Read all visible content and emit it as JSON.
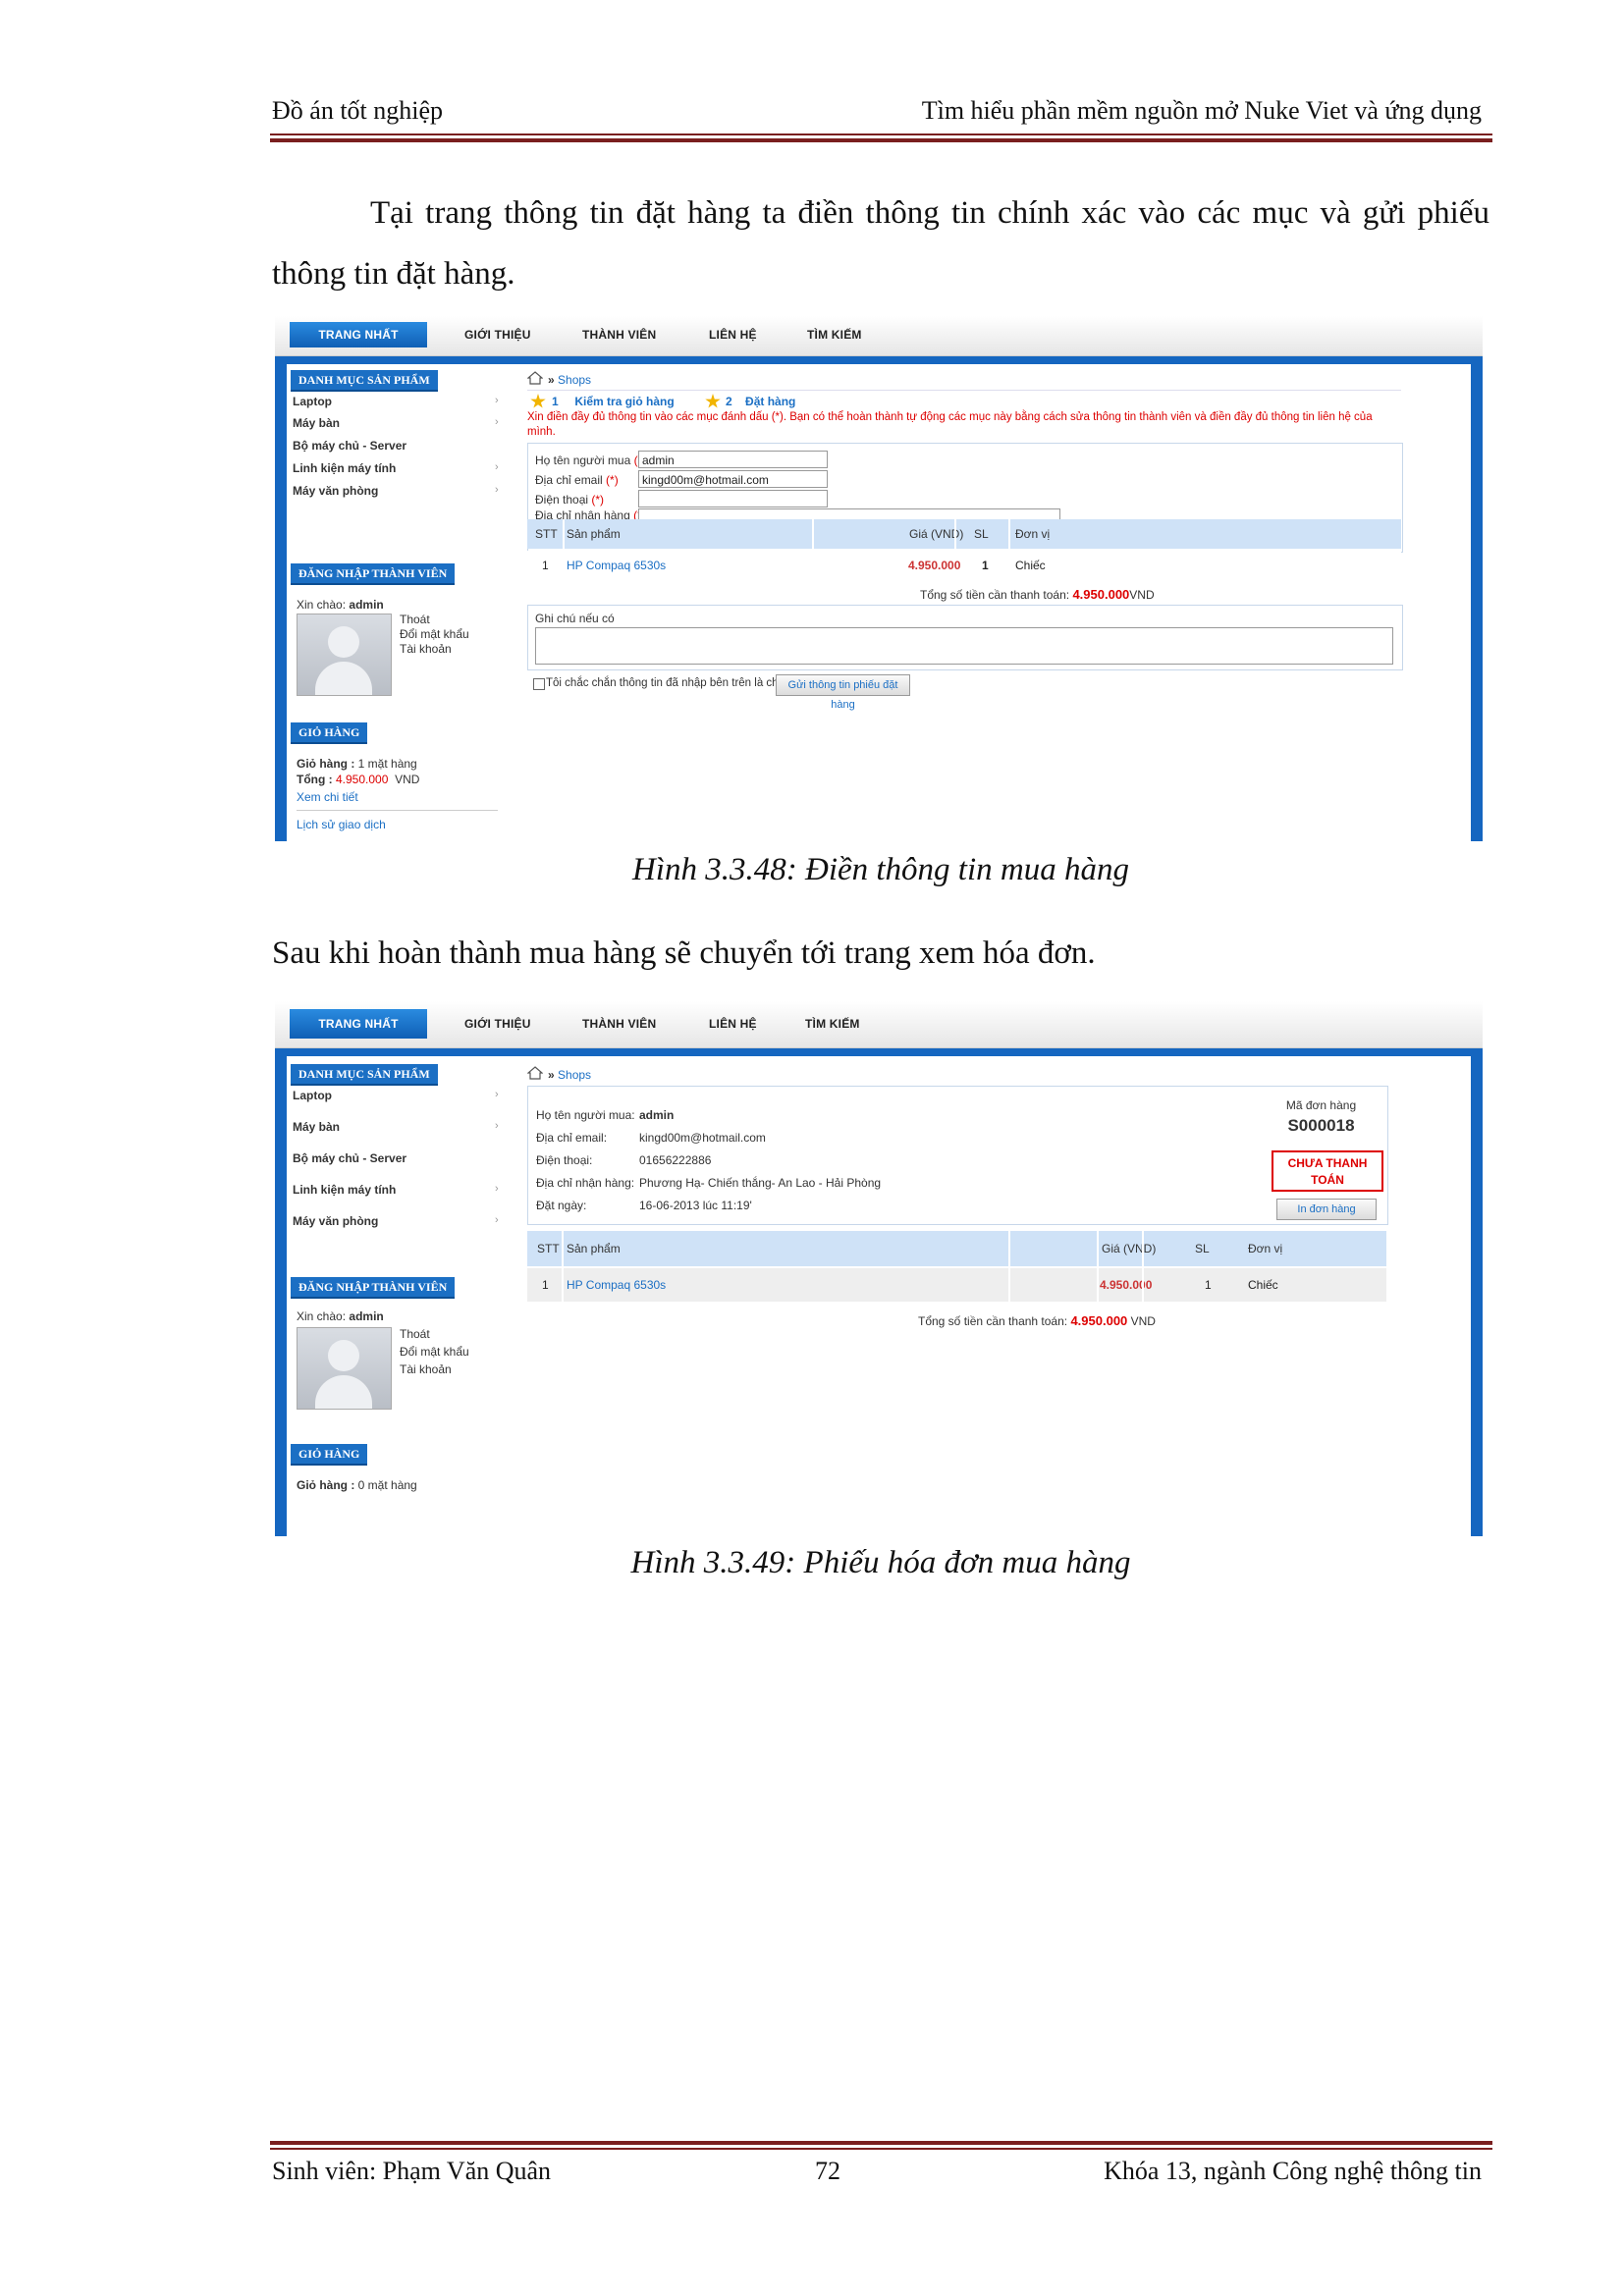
{
  "header": {
    "left": "Đồ án tốt nghiệp",
    "right": "Tìm hiểu phần mềm nguồn mở Nuke Viet và ứng dụng"
  },
  "intro_text": "Tại trang thông tin đặt hàng ta điền thông tin chính xác vào các mục và gửi phiếu thông tin đặt hàng.",
  "between_text": "Sau khi hoàn thành mua hàng sẽ chuyển tới trang xem hóa đơn.",
  "captions": {
    "fig1": "Hình 3.3.48: Điền thông tin mua hàng",
    "fig2": "Hình 3.3.49: Phiếu hóa đơn mua hàng"
  },
  "nav": [
    "TRANG NHẤT",
    "GIỚI THIỆU",
    "THÀNH VIÊN",
    "LIÊN HỆ",
    "TÌM KIẾM"
  ],
  "sidebar": {
    "categories_title": "DANH MỤC SẢN PHẨM",
    "categories": [
      "Laptop",
      "Máy bàn",
      "Bộ máy chủ - Server",
      "Linh kiện máy tính",
      "Máy văn phòng"
    ],
    "login_title": "ĐĂNG NHẬP THÀNH VIÊN",
    "greeting": "Xin chào:",
    "username": "admin",
    "links": [
      "Thoát",
      "Đổi mật khẩu",
      "Tài khoản"
    ],
    "cart_title": "GIỎ HÀNG"
  },
  "fig1": {
    "breadcrumb": "Shops",
    "step1_num": "1",
    "step1_label": "Kiểm tra giỏ hàng",
    "step2_num": "2",
    "step2_label": "Đặt hàng",
    "notice": "Xin điền đầy đủ thông tin vào các mục đánh dấu (*). Bạn có thể hoàn thành tự động các mục này bằng cách sửa thông tin thành viên và điền đầy đủ thông tin liên hệ của mình.",
    "fields": [
      {
        "label": "Họ tên người mua",
        "value": "admin"
      },
      {
        "label": "Địa chỉ email",
        "value": "kingd00m@hotmail.com"
      },
      {
        "label": "Điện thoại",
        "value": ""
      },
      {
        "label": "Địa chỉ nhận hàng",
        "value": ""
      }
    ],
    "required_mark": "(*)",
    "cart_line1_label": "Giỏ hàng :",
    "cart_line1_value": "1 mặt hàng",
    "cart_line2_label": "Tổng :",
    "cart_line2_value": "4.950.000",
    "cart_line2_unit": "VND",
    "cart_link1": "Xem chi tiết",
    "cart_link2": "Lịch sử giao dịch",
    "note_label": "Ghi chú nếu có",
    "confirm_text": "Tôi chắc chắn thông tin đã nhập bên trên là chính xác",
    "submit_label": "Gửi thông tin phiếu đặt hàng"
  },
  "table": {
    "headers": [
      "STT",
      "Sản phẩm",
      "Giá (VND)",
      "SL",
      "Đơn vị"
    ],
    "row": [
      "1",
      "HP Compaq 6530s",
      "4.950.000",
      "1",
      "Chiếc"
    ],
    "total_label": "Tổng số tiền cần thanh toán:",
    "total_value": "4.950.000",
    "total_unit": "VND"
  },
  "fig2": {
    "breadcrumb": "Shops",
    "info": [
      {
        "label": "Họ tên người mua:",
        "value": "admin"
      },
      {
        "label": "Địa chỉ email:",
        "value": "kingd00m@hotmail.com"
      },
      {
        "label": "Điện thoại:",
        "value": "01656222886"
      },
      {
        "label": "Địa chỉ nhận hàng:",
        "value": "Phương Hạ- Chiến thắng- An Lao - Hải Phòng"
      },
      {
        "label": "Đặt ngày:",
        "value": "16-06-2013 lúc 11:19'"
      }
    ],
    "order_label": "Mã đơn hàng",
    "order_code": "S000018",
    "status_line1": "CHƯA THANH",
    "status_line2": "TOÁN",
    "print_label": "In đơn hàng",
    "cart_line1_label": "Giỏ hàng :",
    "cart_line1_value": "0 mặt hàng"
  },
  "footer": {
    "left": "Sinh viên: Phạm Văn Quân",
    "page": "72",
    "right": "Khóa 13, ngành Công nghệ thông tin"
  },
  "colors": {
    "rule": "#7a1f1f",
    "blue": "#1566c0",
    "red": "#dd0000"
  }
}
